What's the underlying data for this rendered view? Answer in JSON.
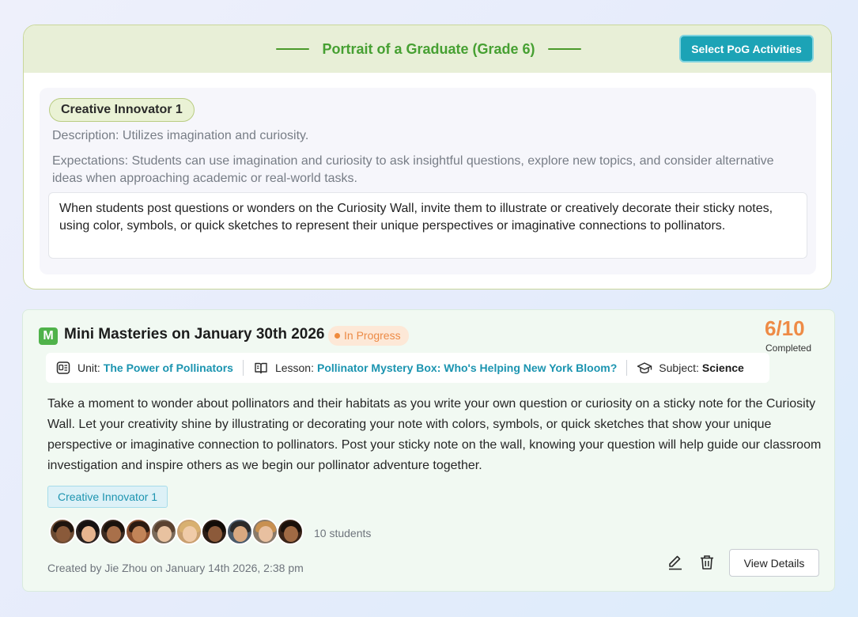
{
  "pog": {
    "title": "Portrait of a Graduate (Grade 6)",
    "select_button": "Select PoG Activities",
    "chip": "Creative Innovator 1",
    "description": "Description: Utilizes imagination and curiosity.",
    "expectations": "Expectations: Students can use imagination and curiosity to ask insightful questions, explore new topics, and consider alternative ideas when approaching academic or real-world tasks.",
    "activity_text": "When students post questions or wonders on the Curiosity Wall, invite them to illustrate or creatively decorate their sticky notes, using color, symbols, or quick sketches to represent their unique perspectives or imaginative connections to pollinators."
  },
  "mini_mastery": {
    "logo_letter": "M",
    "title": "Mini Masteries on January 30th 2026",
    "status": "In Progress",
    "count": "6/10",
    "count_label": "Completed",
    "unit_label": "Unit:",
    "unit_value": "The Power of Pollinators",
    "lesson_label": "Lesson:",
    "lesson_value": "Pollinator Mystery Box: Who's Helping New York Bloom?",
    "subject_label": "Subject:",
    "subject_value": "Science",
    "body": "Take a moment to wonder about pollinators and their habitats as you write your own question or curiosity on a sticky note for the Curiosity Wall. Let your creativity shine by illustrating or decorating your note with colors, symbols, or quick sketches that show your unique perspective or imaginative connection to pollinators. Post your sticky note on the wall, knowing your question will help guide our classroom investigation and inspire others as we begin our pollinator adventure together.",
    "chip": "Creative Innovator 1",
    "students_label": "10 students",
    "created": "Created by Jie Zhou on January 14th 2026, 2:38 pm",
    "view_button": "View Details"
  },
  "colors": {
    "accent_green": "#46a032",
    "teal": "#1ca3b6",
    "orange": "#ee8b46"
  },
  "icons": [
    "unit-icon",
    "lesson-book-icon",
    "graduation-cap-icon",
    "edit-pencil-icon",
    "trash-icon"
  ]
}
